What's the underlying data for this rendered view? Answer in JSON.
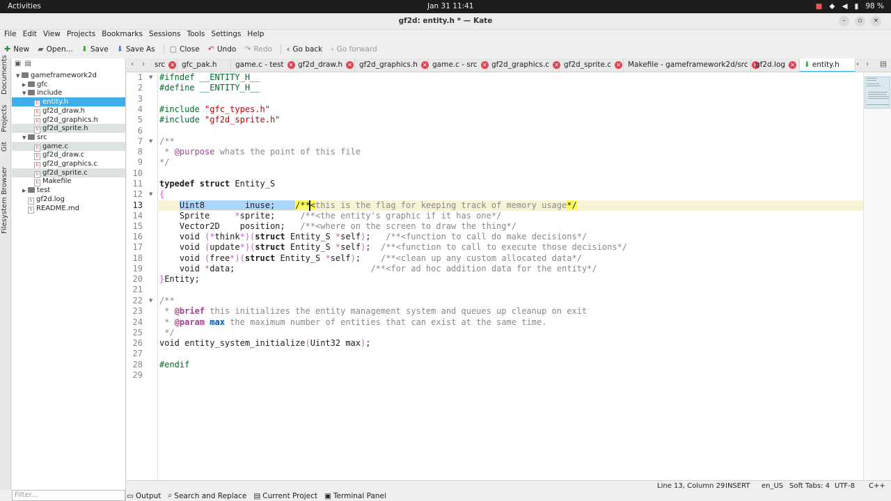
{
  "system": {
    "activities": "Activities",
    "clock": "Jan 31  11:41",
    "battery": "98 %"
  },
  "window": {
    "title": "gf2d: entity.h * — Kate"
  },
  "menu": [
    "File",
    "Edit",
    "View",
    "Projects",
    "Bookmarks",
    "Sessions",
    "Tools",
    "Settings",
    "Help"
  ],
  "toolbar": {
    "new": "New",
    "open": "Open...",
    "save": "Save",
    "save_as": "Save As",
    "close": "Close",
    "undo": "Undo",
    "redo": "Redo",
    "go_back": "Go back",
    "go_forward": "Go forward"
  },
  "side_tabs": [
    "Documents",
    "Projects",
    "Git",
    "Filesystem Browser"
  ],
  "tree": [
    {
      "label": "gameframework2d",
      "depth": 0,
      "type": "folder",
      "open": true
    },
    {
      "label": "gfc",
      "depth": 1,
      "type": "folder",
      "open": false
    },
    {
      "label": "include",
      "depth": 1,
      "type": "folder",
      "open": true
    },
    {
      "label": "entity.h",
      "depth": 2,
      "type": "file",
      "selected": true
    },
    {
      "label": "gf2d_draw.h",
      "depth": 2,
      "type": "file"
    },
    {
      "label": "gf2d_graphics.h",
      "depth": 2,
      "type": "file"
    },
    {
      "label": "gf2d_sprite.h",
      "depth": 2,
      "type": "file",
      "alt": true
    },
    {
      "label": "src",
      "depth": 1,
      "type": "folder",
      "open": true
    },
    {
      "label": "game.c",
      "depth": 2,
      "type": "file",
      "alt": true
    },
    {
      "label": "gf2d_draw.c",
      "depth": 2,
      "type": "file"
    },
    {
      "label": "gf2d_graphics.c",
      "depth": 2,
      "type": "file"
    },
    {
      "label": "gf2d_sprite.c",
      "depth": 2,
      "type": "file",
      "alt": true
    },
    {
      "label": "Makefile",
      "depth": 2,
      "type": "file"
    },
    {
      "label": "test",
      "depth": 1,
      "type": "folder",
      "open": false
    },
    {
      "label": "gf2d.log",
      "depth": 1,
      "type": "file"
    },
    {
      "label": "README.md",
      "depth": 1,
      "type": "file"
    }
  ],
  "filter_placeholder": "Filter...",
  "tabs": [
    {
      "label": "src",
      "close": true
    },
    {
      "label": "gfc_pak.h",
      "close": false
    },
    {
      "label": "game.c - test",
      "close": true
    },
    {
      "label": "gf2d_draw.h",
      "close": true
    },
    {
      "label": "gf2d_graphics.h",
      "close": true
    },
    {
      "label": "game.c - src",
      "close": true
    },
    {
      "label": "gf2d_graphics.c",
      "close": true
    },
    {
      "label": "gf2d_sprite.c",
      "close": true
    },
    {
      "label": "Makefile - gameframework2d/src",
      "close": true
    },
    {
      "label": "gf2d.log",
      "close": true
    },
    {
      "label": "entity.h",
      "close": false,
      "active": true
    }
  ],
  "code_lines": [
    "1",
    "2",
    "3",
    "4",
    "5",
    "6",
    "7",
    "8",
    "9",
    "10",
    "11",
    "12",
    "13",
    "14",
    "15",
    "16",
    "17",
    "18",
    "19",
    "20",
    "21",
    "22",
    "23",
    "24",
    "25",
    "26",
    "27",
    "28",
    "29"
  ],
  "current_line": "13",
  "status": {
    "position": "Line 13, Column 29",
    "mode": "INSERT",
    "language": "en_US",
    "indent": "Soft Tabs: 4",
    "encoding": "UTF-8",
    "syntax": "C++"
  },
  "toolviews": [
    "Output",
    "Search and Replace",
    "Current Project",
    "Terminal Panel"
  ],
  "colors": {
    "accent": "#3daee9",
    "close": "#da4453",
    "keyword": "#1f1c1b",
    "comment": "#898887",
    "string": "#bf0303",
    "preprocessor": "#006e28",
    "doxygen": "#a2438f"
  }
}
